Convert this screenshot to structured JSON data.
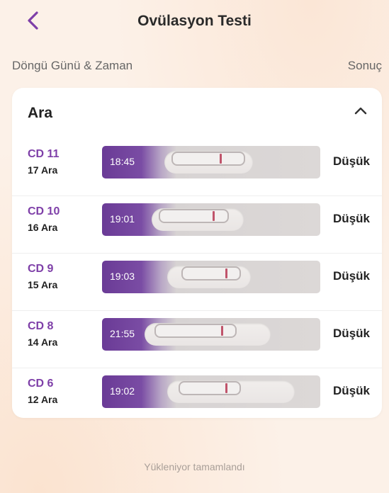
{
  "header": {
    "title": "Ovülasyon Testi",
    "back_icon": "chevron-left-icon",
    "accent": "#7e3fa8"
  },
  "columns": {
    "left": "Döngü Günü & Zaman",
    "right": "Sonuç"
  },
  "group": {
    "month": "Ara",
    "toggle_icon": "chevron-up-icon"
  },
  "tests": [
    {
      "cd": "CD 11",
      "date": "17 Ara",
      "time": "18:45",
      "result": "Düşük"
    },
    {
      "cd": "CD 10",
      "date": "16 Ara",
      "time": "19:01",
      "result": "Düşük"
    },
    {
      "cd": "CD 9",
      "date": "15 Ara",
      "time": "19:03",
      "result": "Düşük"
    },
    {
      "cd": "CD 8",
      "date": "14 Ara",
      "time": "21:55",
      "result": "Düşük"
    },
    {
      "cd": "CD 6",
      "date": "12 Ara",
      "time": "19:02",
      "result": "Düşük"
    }
  ],
  "footer": {
    "status": "Yükleniyor tamamlandı"
  }
}
